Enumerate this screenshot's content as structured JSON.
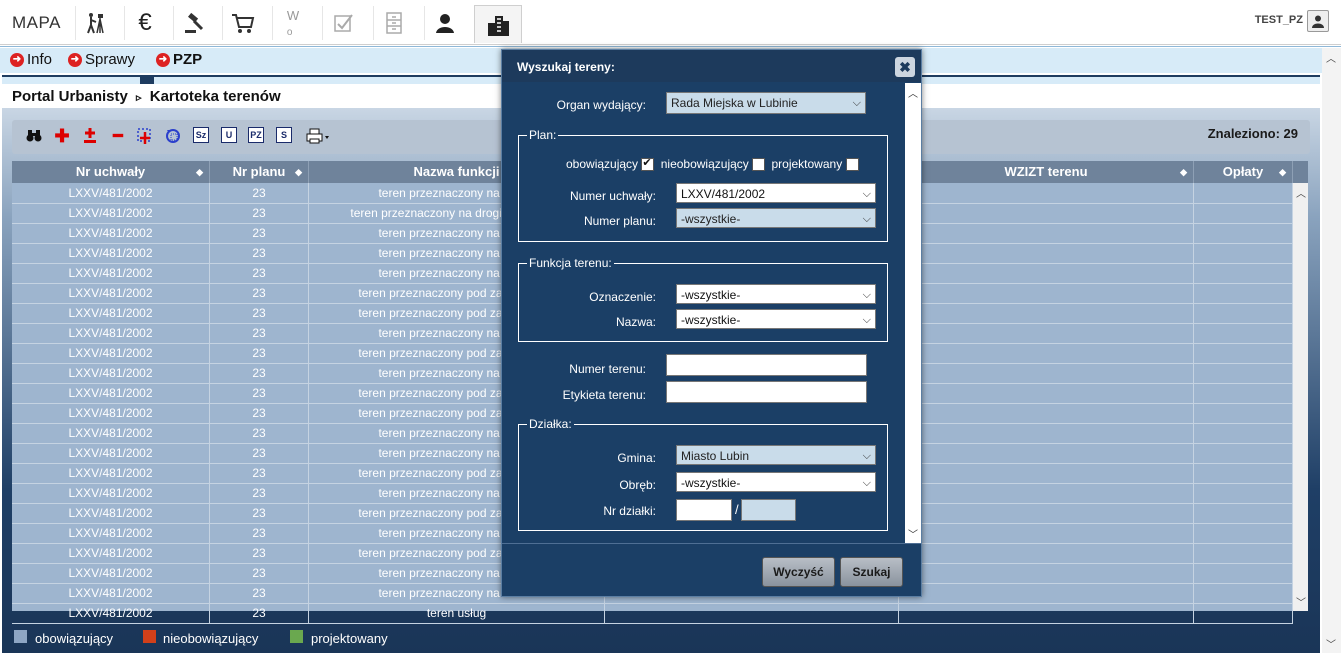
{
  "topbar": {
    "logo": "MAPA",
    "icons": [
      "surveyor-icon",
      "euro-icon",
      "gavel-icon",
      "cart-icon",
      "w-icon",
      "check-doc-icon",
      "cabinet-icon",
      "person-icon",
      "buildings-icon"
    ],
    "user": "TEST_PZ"
  },
  "nav": {
    "items": [
      "Info",
      "Sprawy",
      "PZP"
    ]
  },
  "breadcrumb": {
    "root": "Portal Urbanisty",
    "sep": "▹",
    "current": "Kartoteka terenów"
  },
  "toolbar": {
    "found": "Znaleziono: 29",
    "boxes": [
      "Sz",
      "U",
      "PZ",
      "S"
    ]
  },
  "grid": {
    "columns": [
      "Nr uchwały",
      "Nr planu",
      "Nazwa funkcji",
      "WZIZT terenu",
      "Opłaty"
    ],
    "rows": [
      [
        "LXXV/481/2002",
        "23",
        "teren przeznaczony na zieleń"
      ],
      [
        "LXXV/481/2002",
        "23",
        "teren przeznaczony na drogi dojazdowe"
      ],
      [
        "LXXV/481/2002",
        "23",
        "teren przeznaczony na zieleń"
      ],
      [
        "LXXV/481/2002",
        "23",
        "teren przeznaczony na zieleń"
      ],
      [
        "LXXV/481/2002",
        "23",
        "teren przeznaczony na zieleń"
      ],
      [
        "LXXV/481/2002",
        "23",
        "teren przeznaczony pod zabudowę g"
      ],
      [
        "LXXV/481/2002",
        "23",
        "teren przeznaczony pod zabudowę g"
      ],
      [
        "LXXV/481/2002",
        "23",
        "teren przeznaczony na zieleń"
      ],
      [
        "LXXV/481/2002",
        "23",
        "teren przeznaczony pod zabudowę g"
      ],
      [
        "LXXV/481/2002",
        "23",
        "teren przeznaczony na zieleń"
      ],
      [
        "LXXV/481/2002",
        "23",
        "teren przeznaczony pod zabudowę g"
      ],
      [
        "LXXV/481/2002",
        "23",
        "teren przeznaczony pod zabudowę g"
      ],
      [
        "LXXV/481/2002",
        "23",
        "teren przeznaczony na zieleń"
      ],
      [
        "LXXV/481/2002",
        "23",
        "teren przeznaczony na zieleń"
      ],
      [
        "LXXV/481/2002",
        "23",
        "teren przeznaczony pod zabudowę g"
      ],
      [
        "LXXV/481/2002",
        "23",
        "teren przeznaczony na zieleń"
      ],
      [
        "LXXV/481/2002",
        "23",
        "teren przeznaczony pod zabudowę g"
      ],
      [
        "LXXV/481/2002",
        "23",
        "teren przeznaczony na zieleń"
      ],
      [
        "LXXV/481/2002",
        "23",
        "teren przeznaczony pod zabudowę g"
      ],
      [
        "LXXV/481/2002",
        "23",
        "teren przeznaczony na zieleń"
      ],
      [
        "LXXV/481/2002",
        "23",
        "teren przeznaczony na zieleń"
      ],
      [
        "LXXV/481/2002",
        "23",
        "teren usług"
      ]
    ]
  },
  "legend": {
    "items": [
      {
        "label": "obowiązujący",
        "color": "#8ea6c4"
      },
      {
        "label": "nieobowiązujący",
        "color": "#d2401a"
      },
      {
        "label": "projektowany",
        "color": "#6aa84f"
      }
    ]
  },
  "dialog": {
    "title": "Wyszukaj tereny:",
    "close": "✖",
    "organ_label": "Organ wydający:",
    "organ_value": "Rada Miejska w Lubinie",
    "plan_legend": "Plan:",
    "chk_obow": "obowiązujący",
    "chk_nieobow": "nieobowiązujący",
    "chk_proj": "projektowany",
    "numer_uchwaly_label": "Numer uchwały:",
    "numer_uchwaly_value": "LXXV/481/2002",
    "numer_planu_label": "Numer planu:",
    "numer_planu_value": "-wszystkie-",
    "funkcja_legend": "Funkcja terenu:",
    "oznaczenie_label": "Oznaczenie:",
    "oznaczenie_value": "-wszystkie-",
    "nazwa_label": "Nazwa:",
    "nazwa_value": "-wszystkie-",
    "numer_terenu_label": "Numer terenu:",
    "etykieta_label": "Etykieta terenu:",
    "dzialka_legend": "Działka:",
    "gmina_label": "Gmina:",
    "gmina_value": "Miasto Lubin",
    "obreb_label": "Obręb:",
    "obreb_value": "-wszystkie-",
    "nr_dzialki_label": "Nr działki:",
    "slash": "/",
    "clear_button": "Wyczyść",
    "search_button": "Szukaj"
  }
}
